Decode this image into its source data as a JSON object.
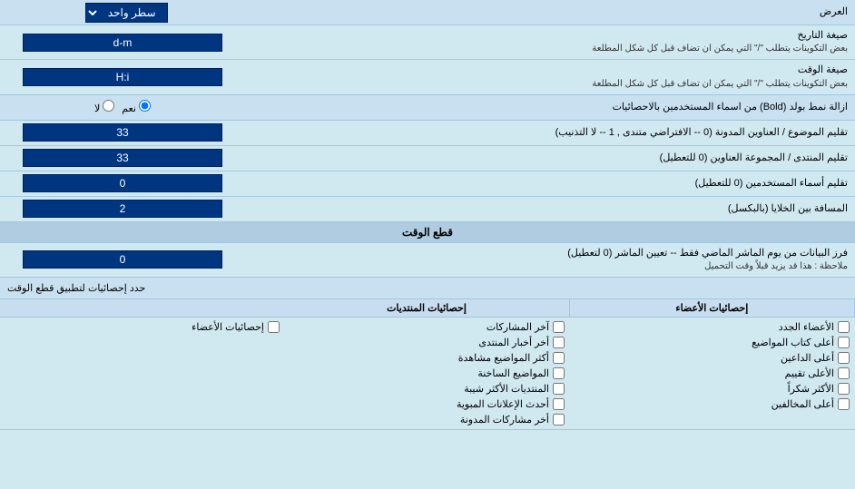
{
  "page": {
    "title": "العرض",
    "dropdown_label": "سطر واحد",
    "date_format_label": "صيغة التاريخ",
    "date_format_hint": "بعض التكوينات يتطلب \"/\" التي يمكن ان تضاف قبل كل شكل المطلعة",
    "date_format_value": "d-m",
    "time_format_label": "صيغة الوقت",
    "time_format_hint": "بعض التكوينات يتطلب \"/\" التي يمكن ان تضاف قبل كل شكل المطلعة",
    "time_format_value": "H:i",
    "bold_label": "ازالة نمط بولد (Bold) من اسماء المستخدمين بالاحصائيات",
    "radio_yes": "نعم",
    "radio_no": "لا",
    "topics_label": "تقليم الموضوع / العناوين المدونة (0 -- الافتراضي متندى , 1 -- لا التذنيب)",
    "topics_value": "33",
    "forum_label": "تقليم المنتدى / المجموعة العناوين (0 للتعطيل)",
    "forum_value": "33",
    "users_label": "تقليم أسماء المستخدمين (0 للتعطيل)",
    "users_value": "0",
    "gap_label": "المسافة بين الخلايا (بالبكسل)",
    "gap_value": "2",
    "time_cutoff_header": "قطع الوقت",
    "cutoff_label": "فرز البيانات من يوم الماشر الماضي فقط -- تعيين الماشر (0 لتعطيل)",
    "cutoff_hint": "ملاحظة : هذا قد يزيد قبلاً وقت التحميل",
    "cutoff_value": "0",
    "apply_label": "حدد إحصائيات لتطبيق قطع الوقت",
    "col1_header": "إحصائيات الأعضاء",
    "col2_header": "إحصائيات المنتديات",
    "col3_header": "",
    "col1_items": [
      "الأعضاء الجدد",
      "أعلى كتاب المواضيع",
      "أعلى الداعين",
      "الأعلى تقييم",
      "الأكثر شكراً",
      "أعلى المخالفين"
    ],
    "col2_items": [
      "آخر المشاركات",
      "أخر أخبار المنتدى",
      "أكثر المواضيع مشاهدة",
      "المواضيع الساخنة",
      "المنتديات الأكثر شيبة",
      "أحدث الإعلانات المبوية",
      "أخر مشاركات المدونة"
    ],
    "col3_items": [
      "إحصائيات الأعضاء"
    ]
  }
}
